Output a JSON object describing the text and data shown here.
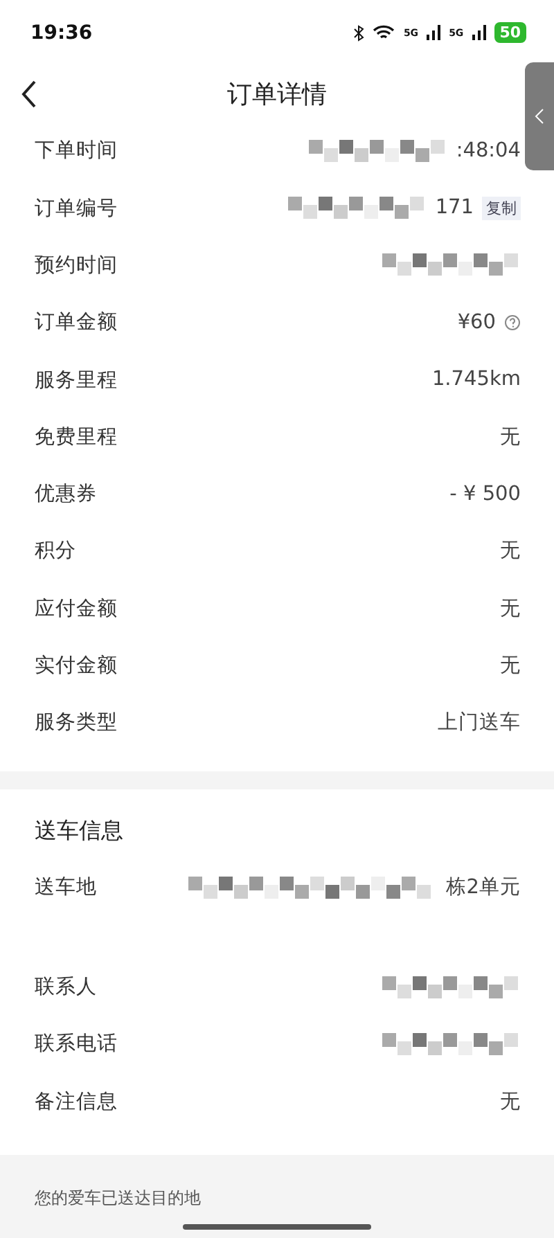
{
  "status_bar": {
    "time": "19:36",
    "network_labels": [
      "5G",
      "5G"
    ],
    "battery": "50"
  },
  "header": {
    "title": "订单详情"
  },
  "order_rows": [
    {
      "label": "下单时间",
      "value": ":48:04",
      "masked": true
    },
    {
      "label": "订单编号",
      "value": "171",
      "masked": true,
      "action": "复制"
    },
    {
      "label": "预约时间",
      "value": "",
      "masked": true
    },
    {
      "label": "订单金额",
      "value": "¥60",
      "masked": false,
      "help": true
    },
    {
      "label": "服务里程",
      "value": "1.745km",
      "masked": false
    },
    {
      "label": "免费里程",
      "value": "无",
      "masked": false
    },
    {
      "label": "优惠券",
      "value": "- ¥ 500",
      "masked": false
    },
    {
      "label": "积分",
      "value": "无",
      "masked": false
    },
    {
      "label": "应付金额",
      "value": "无",
      "masked": false
    },
    {
      "label": "实付金额",
      "value": "无",
      "masked": false
    },
    {
      "label": "服务类型",
      "value": "上门送车",
      "masked": false
    }
  ],
  "delivery": {
    "title": "送车信息",
    "rows": [
      {
        "label": "送车地",
        "value": "栋2单元",
        "masked": true,
        "tall": true
      },
      {
        "label": "联系人",
        "value": "",
        "masked": true
      },
      {
        "label": "联系电话",
        "value": "",
        "masked": true
      },
      {
        "label": "备注信息",
        "value": "无",
        "masked": false
      }
    ]
  },
  "footer": {
    "message": "您的爱车已送达目的地"
  }
}
